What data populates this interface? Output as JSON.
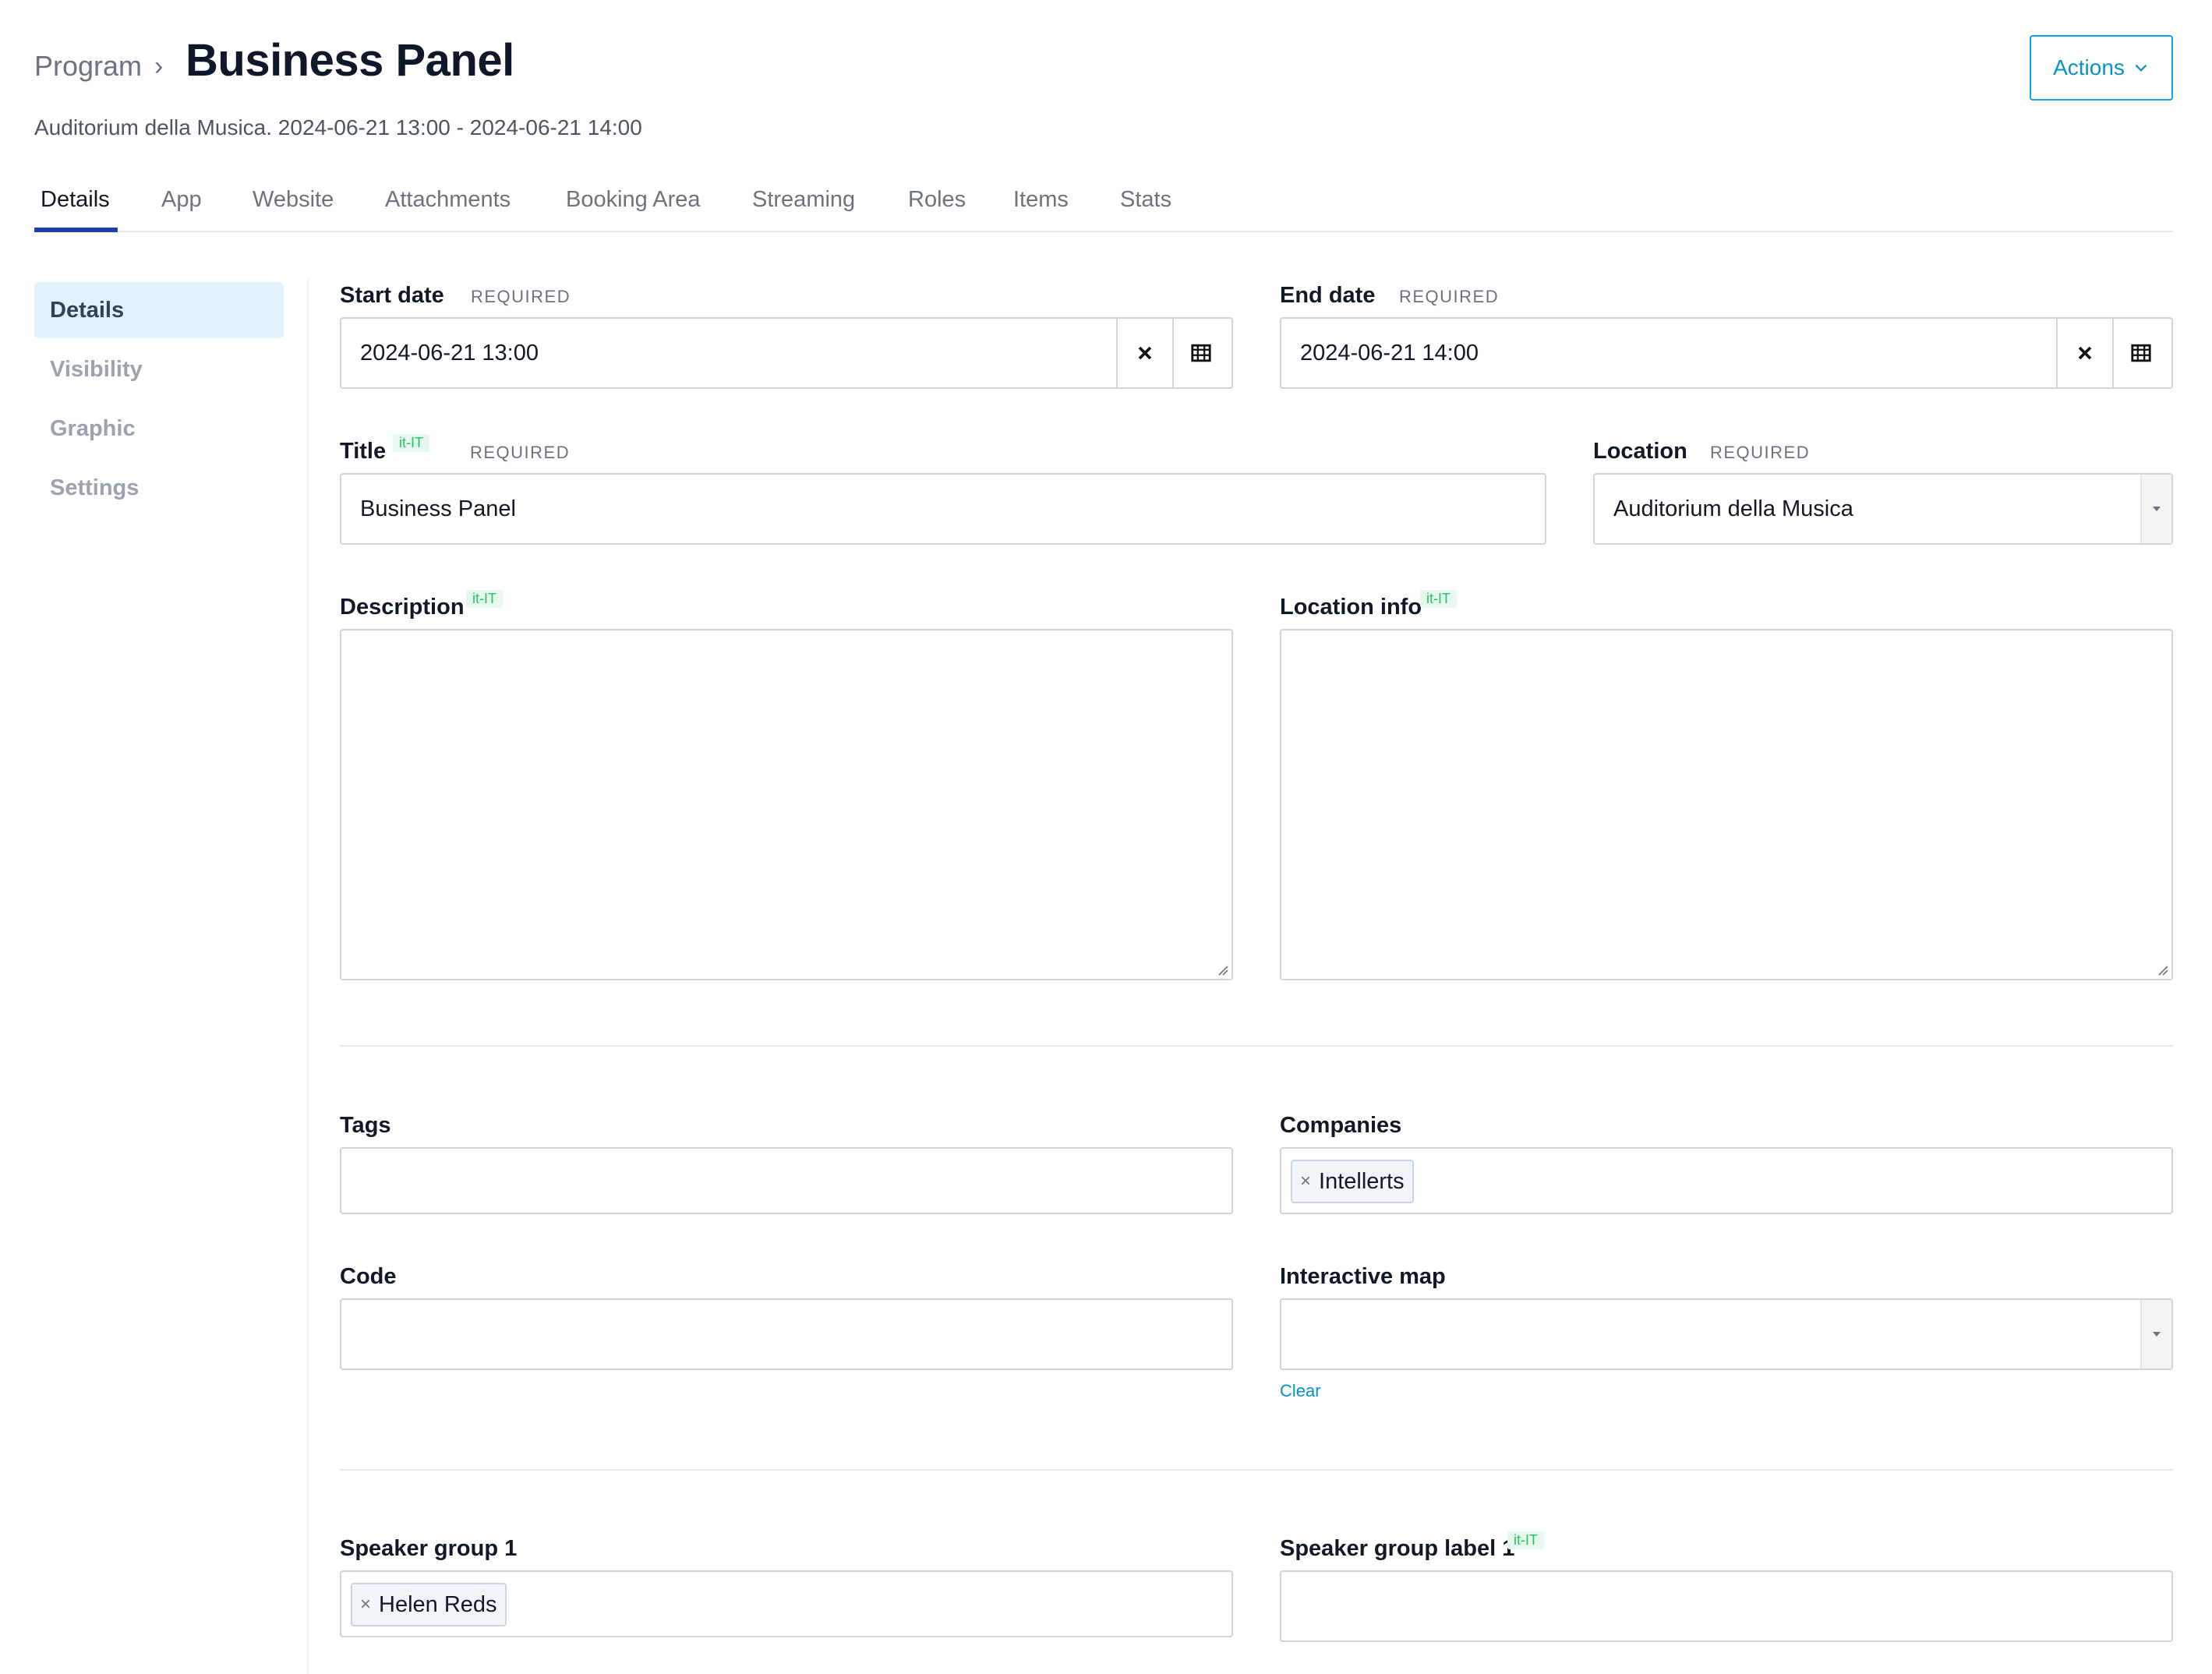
{
  "header": {
    "breadcrumb_parent": "Program",
    "title": "Business Panel",
    "subtitle": "Auditorium della Musica. 2024-06-21 13:00 - 2024-06-21 14:00",
    "actions_label": "Actions"
  },
  "tabs": [
    {
      "label": "Details",
      "active": true
    },
    {
      "label": "App"
    },
    {
      "label": "Website"
    },
    {
      "label": "Attachments"
    },
    {
      "label": "Booking Area"
    },
    {
      "label": "Streaming"
    },
    {
      "label": "Roles"
    },
    {
      "label": "Items"
    },
    {
      "label": "Stats"
    }
  ],
  "sidebar": {
    "items": [
      {
        "label": "Details",
        "active": true
      },
      {
        "label": "Visibility"
      },
      {
        "label": "Graphic"
      },
      {
        "label": "Settings"
      }
    ]
  },
  "form": {
    "required_text": "REQUIRED",
    "locale_tag": "it-IT",
    "start_date": {
      "label": "Start date",
      "value": "2024-06-21 13:00"
    },
    "end_date": {
      "label": "End date",
      "value": "2024-06-21 14:00"
    },
    "title": {
      "label": "Title",
      "value": "Business Panel"
    },
    "location": {
      "label": "Location",
      "value": "Auditorium della Musica"
    },
    "description": {
      "label": "Description",
      "value": ""
    },
    "location_info": {
      "label": "Location info",
      "value": ""
    },
    "tags": {
      "label": "Tags",
      "value": ""
    },
    "companies": {
      "label": "Companies",
      "chips": [
        "Intellerts"
      ]
    },
    "code": {
      "label": "Code",
      "value": ""
    },
    "interactive_map": {
      "label": "Interactive map",
      "value": "",
      "clear_label": "Clear"
    },
    "speaker_group_1": {
      "label": "Speaker group 1",
      "chips": [
        "Helen Reds"
      ]
    },
    "speaker_group_label_1": {
      "label": "Speaker group label 1",
      "value": ""
    }
  },
  "icons": {
    "clear": "close-icon",
    "calendar": "calendar-grid-icon",
    "dropdown": "caret-down-icon",
    "chevron": "chevron-right-icon",
    "chip_remove": "×"
  },
  "colors": {
    "accent": "#0891c9",
    "active_tab_underline": "#1e40af",
    "sidebar_active_bg": "#e0f2fe",
    "locale_green": "#22c55e"
  }
}
